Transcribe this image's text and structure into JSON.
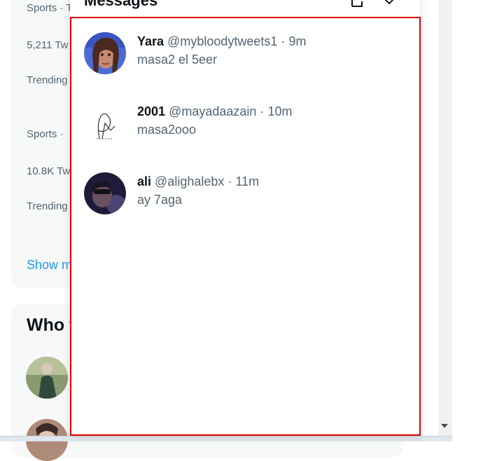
{
  "trends": {
    "items": [
      {
        "category": "Sports · T",
        "count": "5,211 Tw",
        "status": "Trending"
      },
      {
        "category": "Sports ·",
        "count": "10.8K Tw",
        "status": "Trending"
      }
    ],
    "show_more": "Show m"
  },
  "who_to_follow": {
    "title": "Who t"
  },
  "messages": {
    "title": "Messages",
    "header_icons": [
      "new-message-icon",
      "collapse-icon"
    ],
    "conversations": [
      {
        "name": "Yara",
        "handle": "@mybloodytweets1",
        "separator": "·",
        "time": "9m",
        "preview": "masa2 el 5eer",
        "avatar": "avatar-yara"
      },
      {
        "name": "2001",
        "handle": "@mayadaazain",
        "separator": "·",
        "time": "10m",
        "preview": "masa2ooo",
        "avatar": "avatar-2001"
      },
      {
        "name": "ali",
        "handle": "@alighalebx",
        "separator": "·",
        "time": "11m",
        "preview": "ay 7aga",
        "avatar": "avatar-ali"
      }
    ]
  },
  "colors": {
    "accent": "#1d9bf0",
    "highlight_border": "#e00000",
    "text_primary": "#0f1419",
    "text_secondary": "#536471"
  }
}
